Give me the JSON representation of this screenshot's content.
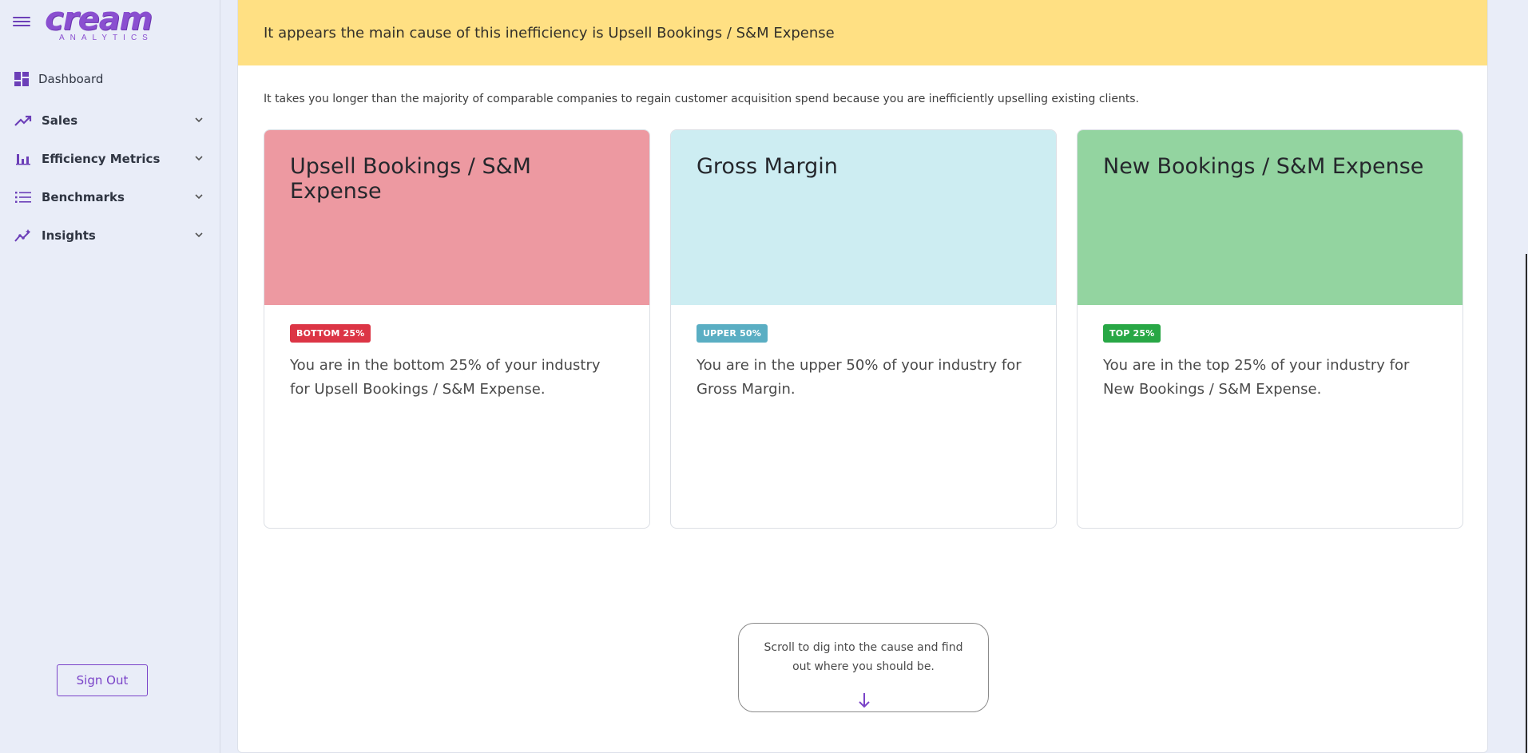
{
  "sidebar": {
    "logo_word": "cream",
    "logo_sub": "ANALYTICS",
    "items": [
      {
        "label": "Dashboard",
        "icon": "dashboard-icon"
      },
      {
        "label": "Sales",
        "icon": "trending-up-icon"
      },
      {
        "label": "Efficiency Metrics",
        "icon": "bar-chart-icon"
      },
      {
        "label": "Benchmarks",
        "icon": "list-icon"
      },
      {
        "label": "Insights",
        "icon": "insights-icon"
      }
    ],
    "sign_out": "Sign Out"
  },
  "main": {
    "alert": "It appears the main cause of this inefficiency is Upsell Bookings / S&M Expense",
    "description": "It takes you longer than the majority of comparable companies to regain customer acquisition spend because you are inefficiently upselling existing clients.",
    "cards": [
      {
        "title": "Upsell Bookings / S&M Expense",
        "badge": "BOTTOM 25%",
        "text": "You are in the bottom 25% of your industry for Upsell Bookings / S&M Expense.",
        "head_color": "#ed99a1",
        "badge_color": "#dc3545"
      },
      {
        "title": "Gross Margin",
        "badge": "UPPER 50%",
        "text": "You are in the upper 50% of your industry for Gross Margin.",
        "head_color": "#cdedf2",
        "badge_color": "#5aaec3"
      },
      {
        "title": "New Bookings / S&M Expense",
        "badge": "TOP 25%",
        "text": "You are in the top 25% of your industry for New Bookings / S&M Expense.",
        "head_color": "#93d4a0",
        "badge_color": "#28a745"
      }
    ],
    "scroll_hint": "Scroll to dig into the cause and find out where you should be."
  },
  "colors": {
    "accent": "#7a43c8",
    "sidebar_bg": "#e9edf8",
    "alert_bg": "#ffe083"
  }
}
